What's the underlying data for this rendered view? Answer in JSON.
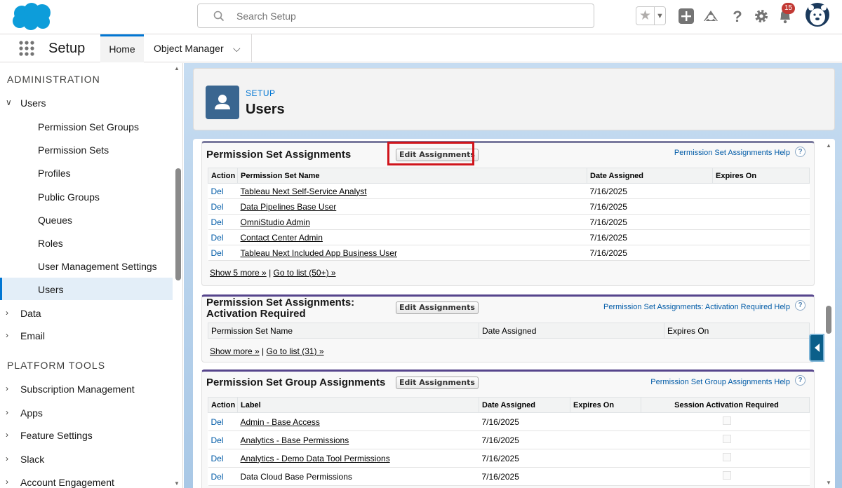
{
  "header": {
    "search_placeholder": "Search Setup",
    "notification_count": "15"
  },
  "nav": {
    "app_name": "Setup",
    "tabs": [
      {
        "label": "Home"
      },
      {
        "label": "Object Manager"
      }
    ]
  },
  "sidebar": {
    "section_admin": "ADMINISTRATION",
    "users_group": "Users",
    "user_items": [
      "Permission Set Groups",
      "Permission Sets",
      "Profiles",
      "Public Groups",
      "Queues",
      "Roles",
      "User Management Settings",
      "Users"
    ],
    "data": "Data",
    "email": "Email",
    "section_platform": "PLATFORM TOOLS",
    "platform_items": [
      "Subscription Management",
      "Apps",
      "Feature Settings",
      "Slack",
      "Account Engagement"
    ]
  },
  "page_header": {
    "eyebrow": "SETUP",
    "title": "Users"
  },
  "psa": {
    "title": "Permission Set Assignments",
    "edit_label": "Edit Assignments",
    "help_label": "Permission Set Assignments Help",
    "columns": [
      "Action",
      "Permission Set Name",
      "Date Assigned",
      "Expires On"
    ],
    "rows": [
      {
        "action": "Del",
        "name": "Tableau Next Self-Service Analyst",
        "date": "7/16/2025",
        "expires": ""
      },
      {
        "action": "Del",
        "name": "Data Pipelines Base User",
        "date": "7/16/2025",
        "expires": ""
      },
      {
        "action": "Del",
        "name": "OmniStudio Admin",
        "date": "7/16/2025",
        "expires": ""
      },
      {
        "action": "Del",
        "name": "Contact Center Admin",
        "date": "7/16/2025",
        "expires": ""
      },
      {
        "action": "Del",
        "name": "Tableau Next Included App Business User",
        "date": "7/16/2025",
        "expires": ""
      }
    ],
    "show_more": "Show 5 more »",
    "separator": "|",
    "go_to_list": "Go to list (50+) »"
  },
  "psa_activation": {
    "title_line1": "Permission Set Assignments:",
    "title_line2": "Activation Required",
    "edit_label": "Edit Assignments",
    "help_label": "Permission Set Assignments: Activation Required Help",
    "columns": [
      "Permission Set Name",
      "Date Assigned",
      "Expires On"
    ],
    "show_more": "Show more »",
    "separator": "|",
    "go_to_list": "Go to list (31) »"
  },
  "psga": {
    "title": "Permission Set Group Assignments",
    "edit_label": "Edit Assignments",
    "help_label": "Permission Set Group Assignments Help",
    "columns": [
      "Action",
      "Label",
      "Date Assigned",
      "Expires On",
      "Session Activation Required"
    ],
    "rows": [
      {
        "action": "Del",
        "label": "Admin - Base Access",
        "date": "7/16/2025",
        "expires": "",
        "session": false
      },
      {
        "action": "Del",
        "label": "Analytics - Base Permissions",
        "date": "7/16/2025",
        "expires": "",
        "session": false
      },
      {
        "action": "Del",
        "label": "Analytics - Demo Data Tool Permissions",
        "date": "7/16/2025",
        "expires": "",
        "session": false
      },
      {
        "action": "Del",
        "label": "Data Cloud Base Permissions",
        "date": "7/16/2025",
        "expires": "",
        "session": false
      }
    ]
  }
}
